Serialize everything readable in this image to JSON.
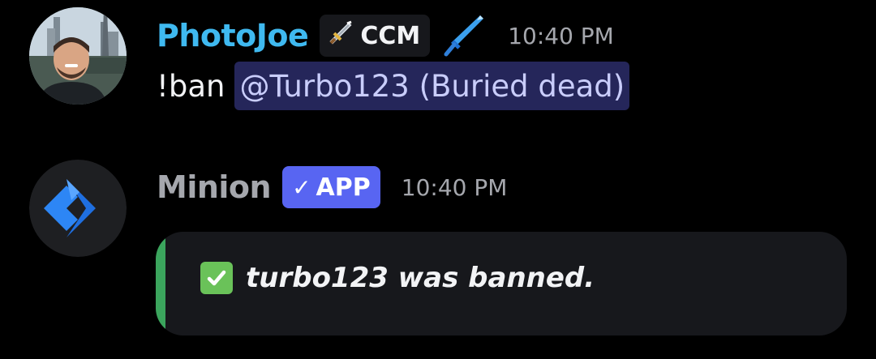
{
  "colors": {
    "background": "#000000",
    "photojoe_name": "#3fb9f0",
    "minion_name": "#a5a7ad",
    "mention_bg": "#25265a",
    "mention_text": "#c9cdfb",
    "app_badge": "#5865f2",
    "embed_bar": "#3ba55d",
    "embed_bg": "#17181c"
  },
  "messages": [
    {
      "author": "PhotoJoe",
      "avatar": "profile-photo",
      "tag": {
        "icon": "sword-icon",
        "label": "CCM"
      },
      "role_icon": "blue-sword-icon",
      "timestamp": "10:40 PM",
      "content": {
        "text": "!ban",
        "mention": "@Turbo123 (Buried dead)"
      }
    },
    {
      "author": "Minion",
      "avatar": "minion-logo",
      "badge": {
        "icon": "checkmark-icon",
        "check": "✓",
        "label": "APP"
      },
      "timestamp": "10:40 PM",
      "embed": {
        "icon": "check-box-icon",
        "description": "turbo123 was banned."
      }
    }
  ]
}
